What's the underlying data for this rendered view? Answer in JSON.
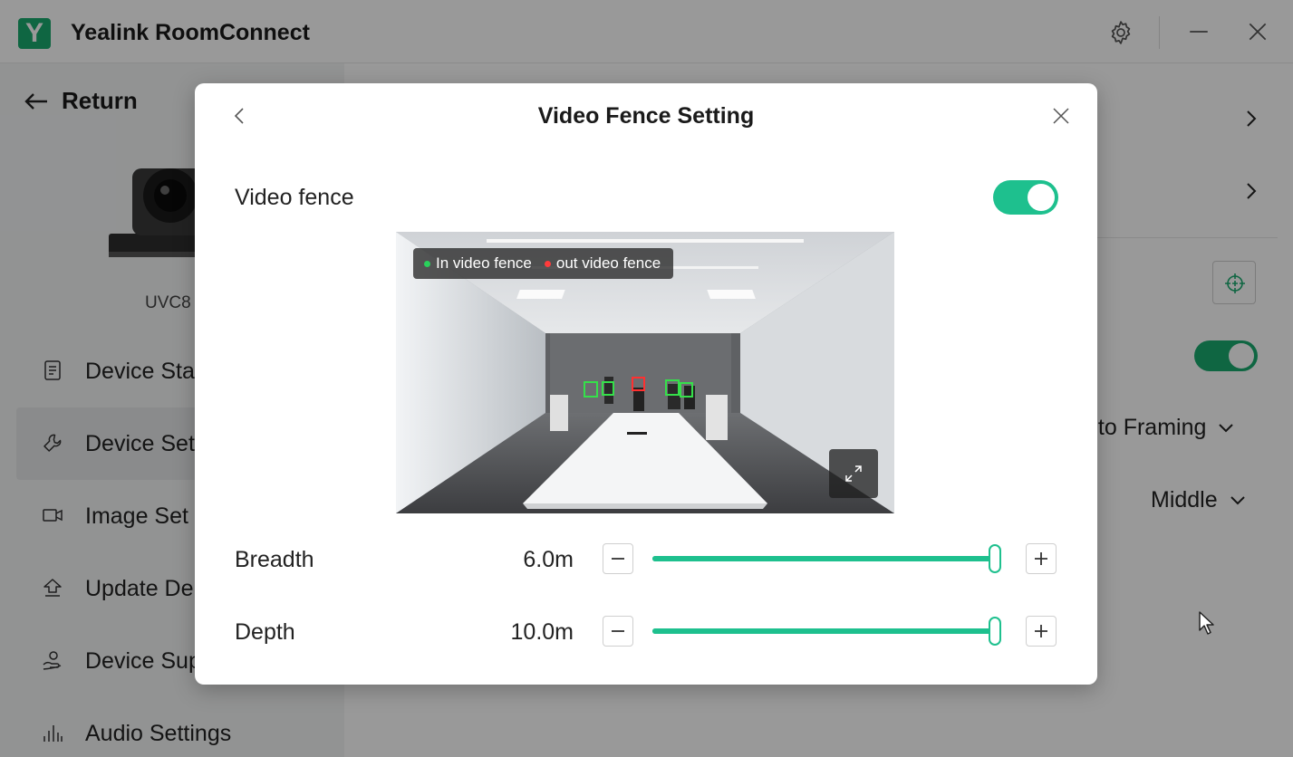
{
  "app": {
    "logo_letter": "Y",
    "title": "Yealink RoomConnect",
    "brand_color": "#1aab6f"
  },
  "sidebar": {
    "return_label": "Return",
    "device_name": "UVC8",
    "items": [
      {
        "label": "Device Sta",
        "icon": "document-icon"
      },
      {
        "label": "Device Set",
        "icon": "wrench-icon"
      },
      {
        "label": "Image Set",
        "icon": "video-camera-icon"
      },
      {
        "label": "Update De",
        "icon": "upload-icon"
      },
      {
        "label": "Device Sup",
        "icon": "support-icon"
      },
      {
        "label": "Audio Settings",
        "icon": "equalizer-icon"
      }
    ]
  },
  "content": {
    "framing_value": "uto Framing",
    "position_value": "Middle"
  },
  "modal": {
    "title": "Video Fence Setting",
    "video_fence_label": "Video fence",
    "video_fence_enabled": true,
    "legend_in": "In video fence",
    "legend_out": "out video fence",
    "breadth": {
      "label": "Breadth",
      "value": "6.0m",
      "level": 1.0
    },
    "depth": {
      "label": "Depth",
      "value": "10.0m",
      "level": 1.0
    },
    "accent_color": "#1ec08e"
  }
}
